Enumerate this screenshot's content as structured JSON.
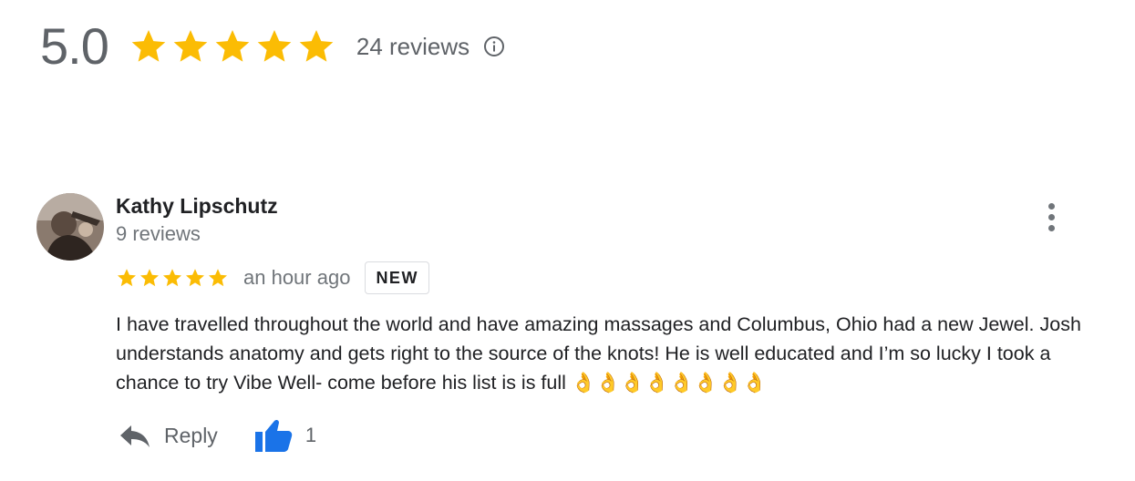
{
  "summary": {
    "rating": "5.0",
    "stars": 5,
    "review_count": "24 reviews",
    "star_color": "#fbbc04"
  },
  "review": {
    "author": "Kathy Lipschutz",
    "author_reviews": "9 reviews",
    "stars": 5,
    "time": "an hour ago",
    "badge": "NEW",
    "text": "I have travelled throughout the world and have amazing massages and Columbus, Ohio had a new Jewel. Josh understands anatomy and gets right to the source of the knots! He is well educated and I’m so lucky I took a chance to try Vibe Well- come before his list is is full 👌👌👌👌👌👌👌👌",
    "actions": {
      "reply_label": "Reply",
      "like_count": "1",
      "like_color": "#1a73e8"
    }
  }
}
